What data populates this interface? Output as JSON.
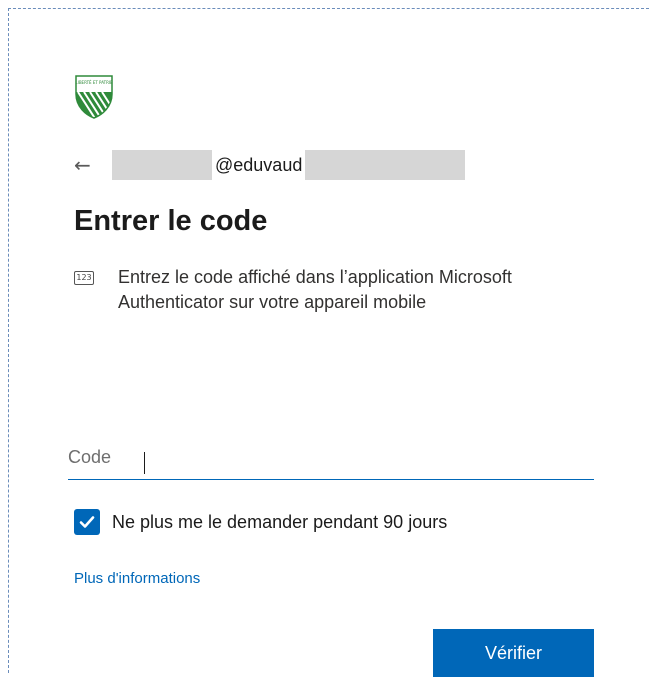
{
  "header": {
    "logo_alt": "LIBERTÉ ET PATRIE"
  },
  "identity": {
    "back_icon": "back-arrow-icon",
    "email_suffix": "@eduvaud"
  },
  "title": "Entrer le code",
  "instruction": {
    "icon": "number-pad-icon",
    "icon_text": "123",
    "text": "Entrez le code affiché dans l’application Microsoft Authenticator sur votre appareil mobile"
  },
  "code_input": {
    "value": "",
    "placeholder": "Code"
  },
  "remember": {
    "checked": true,
    "label": "Ne plus me le demander pendant 90 jours"
  },
  "more_info_link": "Plus d'informations",
  "verify_button": "Vérifier",
  "colors": {
    "accent": "#0067b8",
    "text": "#1b1b1b",
    "redaction": "#d6d6d6",
    "logo_green": "#2e7d32"
  }
}
